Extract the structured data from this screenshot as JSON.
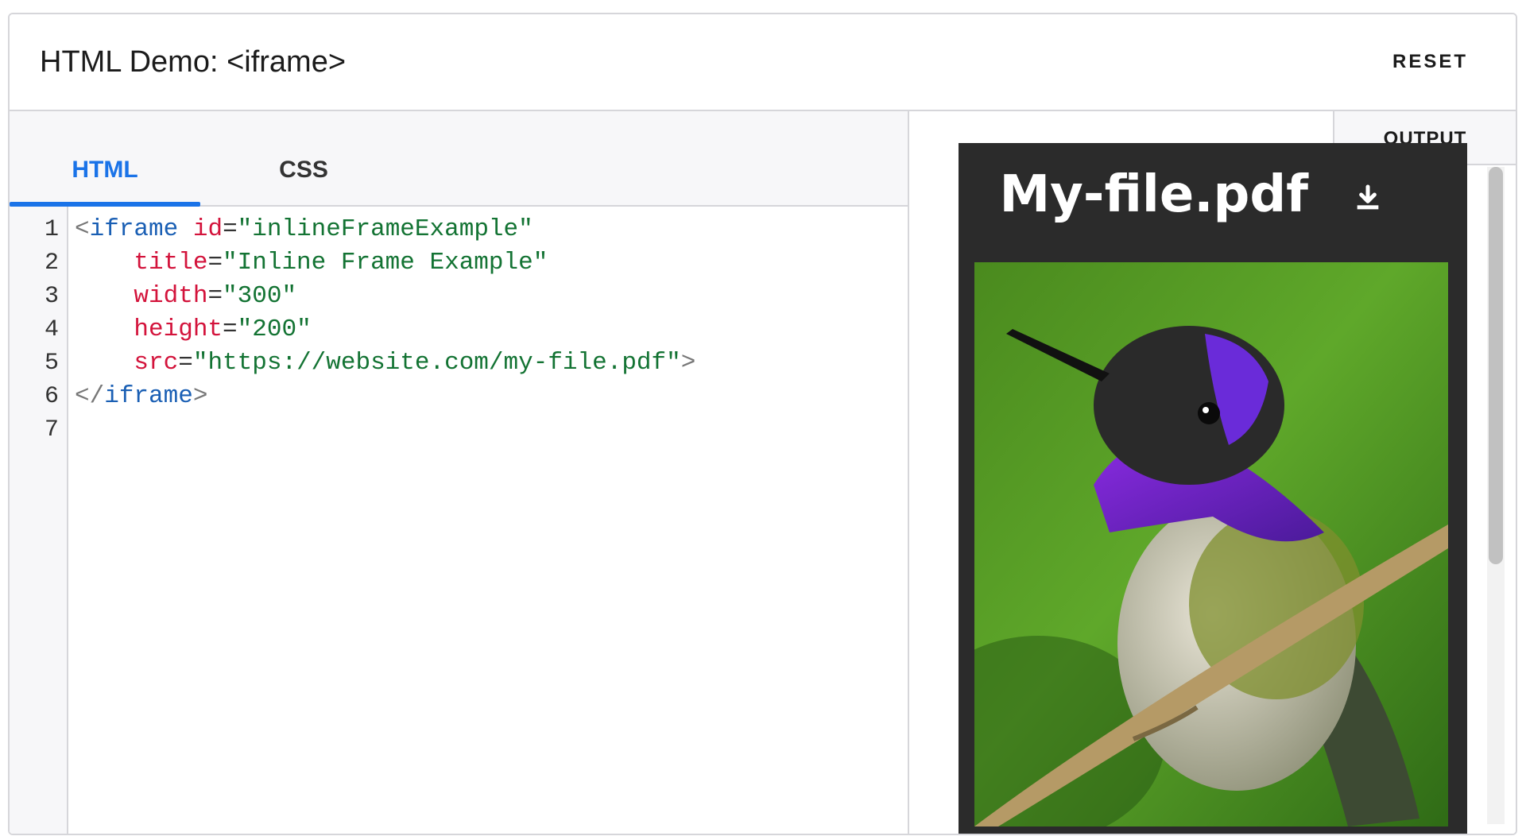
{
  "header": {
    "title": "HTML Demo: <iframe>",
    "reset_label": "RESET"
  },
  "editor": {
    "tabs": [
      {
        "label": "HTML",
        "active": true
      },
      {
        "label": "CSS",
        "active": false
      }
    ],
    "line_numbers": [
      "1",
      "2",
      "3",
      "4",
      "5",
      "6",
      "7"
    ],
    "code": {
      "l1_open": "<",
      "l1_tag": "iframe",
      "l1_attr": "id",
      "l1_eq": "=",
      "l1_val": "\"inlineFrameExample\"",
      "l2_attr": "title",
      "l2_eq": "=",
      "l2_val": "\"Inline Frame Example\"",
      "l3_attr": "width",
      "l3_eq": "=",
      "l3_val": "\"300\"",
      "l4_attr": "height",
      "l4_eq": "=",
      "l4_val": "\"200\"",
      "l5_attr": "src",
      "l5_eq": "=",
      "l5_val": "\"https://website.com/my-file.pdf\"",
      "l5_close": ">",
      "l6_open": "</",
      "l6_tag": "iframe",
      "l6_close": ">"
    }
  },
  "output": {
    "label": "OUTPUT",
    "pdf_file_name": "My-file.pdf",
    "download_icon": "download-icon",
    "image_subject": "hummingbird-photo"
  },
  "colors": {
    "accent": "#1a73e8",
    "tag": "#1a5fb4",
    "attribute": "#d3133b",
    "string": "#137333",
    "pdf_background": "#2b2b2b"
  }
}
